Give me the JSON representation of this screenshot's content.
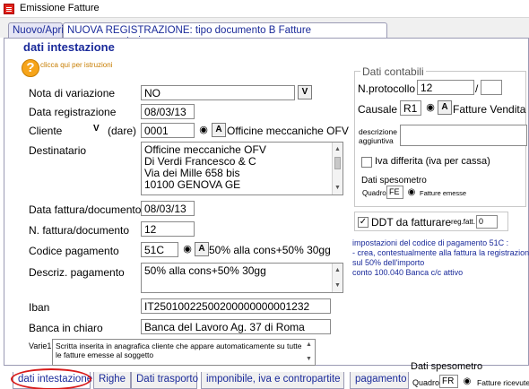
{
  "window": {
    "title": "Emissione Fatture"
  },
  "top_tabs": [
    {
      "label": "Nuovo/Apri"
    },
    {
      "label": "NUOVA REGISTRAZIONE: tipo documento B Fatture accompagnatorie"
    }
  ],
  "section": {
    "title": "dati intestazione",
    "help_text": "clicca qui per istruzioni"
  },
  "form": {
    "nota_variazione": {
      "label": "Nota di variazione",
      "value": "NO",
      "button": "V"
    },
    "data_registrazione": {
      "label": "Data registrazione",
      "value": "08/03/13"
    },
    "cliente": {
      "label": "Cliente",
      "mode_button": "V",
      "mode_text": "(dare)",
      "code": "0001",
      "lookup_button": "A",
      "name": "Officine meccaniche OFV"
    },
    "destinatario": {
      "label": "Destinatario",
      "lines": [
        "Officine meccaniche OFV",
        "Di Verdi Francesco & C",
        "Via dei Mille 658 bis",
        "10100 GENOVA GE"
      ]
    },
    "data_fattura": {
      "label": "Data fattura/documento",
      "value": "08/03/13"
    },
    "n_fattura": {
      "label": "N. fattura/documento",
      "value": "12"
    },
    "codice_pagamento": {
      "label": "Codice pagamento",
      "value": "51C",
      "lookup_button": "A",
      "description": "50% alla cons+50% 30gg"
    },
    "descriz_pagamento": {
      "label": "Descriz. pagamento",
      "value": "50% alla cons+50% 30gg"
    },
    "iban": {
      "label": "Iban",
      "value": "IT25010022500200000000001232"
    },
    "banca": {
      "label": "Banca in chiaro",
      "value": "Banca del Lavoro Ag. 37 di Roma"
    },
    "varie1": {
      "label": "Varie1",
      "value": "Scritta inserita in anagrafica cliente che appare automaticamente su tutte le fatture emesse al soggetto"
    }
  },
  "contabili": {
    "group_title": "Dati contabili",
    "protocollo": {
      "label": "N.protocollo",
      "value": "12",
      "sep": "/",
      "suffix": ""
    },
    "causale": {
      "label": "Causale",
      "code": "R1",
      "lookup_button": "A",
      "description": "Fatture Vendita"
    },
    "descrizione_aggiuntiva": {
      "label_line1": "descrizione",
      "label_line2": "aggiuntiva",
      "value": ""
    },
    "iva_differita": {
      "label": "Iva differita (iva per cassa)",
      "checked": false
    },
    "spesometro": {
      "title": "Dati spesometro",
      "quadro_label": "Quadro",
      "quadro_value": "FE",
      "desc": "Fatture emesse"
    },
    "ddt": {
      "label": "DDT da fatturare",
      "checked": true,
      "reg_label": "reg.fatt.",
      "reg_value": "0"
    }
  },
  "pagamento_note": {
    "lines": [
      "impostazioni del codice di pagamento 51C :",
      "- crea, contestualmente alla fattura la registrazione de",
      "   sul 50% dell'importo",
      "   conto 100.040 Banca c/c attivo"
    ]
  },
  "spesometro_bottom": {
    "title": "Dati spesometro",
    "quadro_label": "Quadro",
    "quadro_value": "FR",
    "desc": "Fatture ricevute"
  },
  "bottom_tabs": [
    {
      "label": "dati intestazione"
    },
    {
      "label": "Righe"
    },
    {
      "label": "Dati trasporto"
    },
    {
      "label": "imponibile, iva e contropartite"
    },
    {
      "label": "pagamento e"
    }
  ]
}
